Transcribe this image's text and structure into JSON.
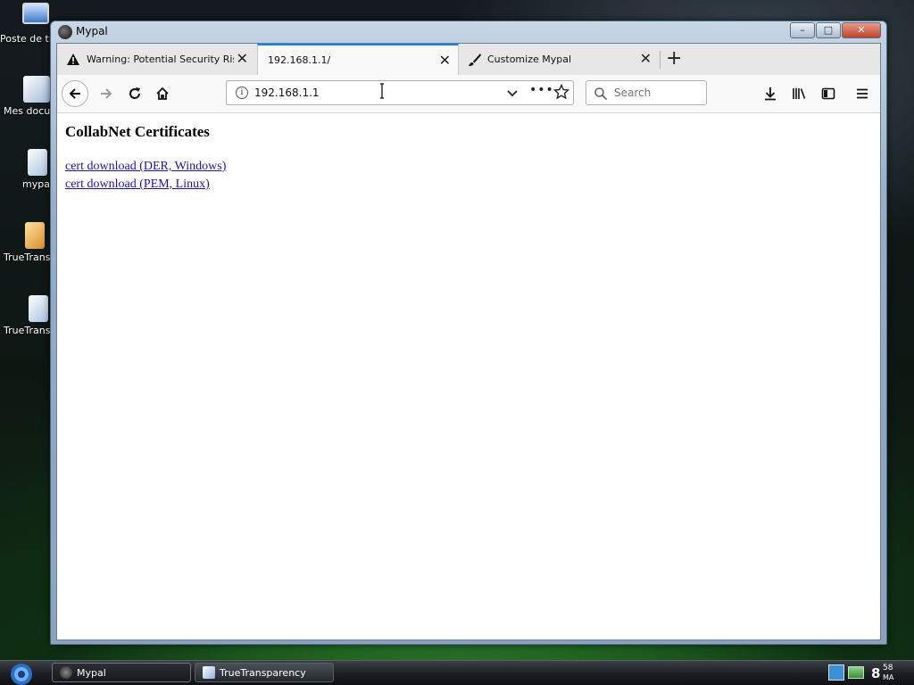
{
  "desktop": {
    "icons": [
      {
        "label": "Poste de travail"
      },
      {
        "label": "Mes docume"
      },
      {
        "label": "mypal"
      },
      {
        "label": "TrueTranspa"
      },
      {
        "label": "TrueTranspa"
      }
    ]
  },
  "window": {
    "title": "Mypal",
    "controls": {
      "minimize": "–",
      "maximize": "□",
      "close": "✕"
    }
  },
  "tabs": [
    {
      "label": "Warning: Potential Security Risk Ah",
      "icon": "warning-icon",
      "active": false
    },
    {
      "label": "192.168.1.1/",
      "active": true
    },
    {
      "label": "Customize Mypal",
      "icon": "brush-icon",
      "active": false
    }
  ],
  "tab_close_glyph": "✕",
  "new_tab_glyph": "+",
  "navbar": {
    "url": "192.168.1.1",
    "info_glyph": "i",
    "more_glyph": "•••",
    "search_placeholder": "Search",
    "menu_glyph": "≡"
  },
  "page": {
    "title": "CollabNet Certificates",
    "links": [
      "cert download (DER, Windows)",
      "cert download (PEM, Linux)"
    ]
  },
  "taskbar": {
    "tasks": [
      {
        "label": "Mypal",
        "active": true
      },
      {
        "label": "TrueTransparency",
        "active": false
      }
    ],
    "clock_hour": "8",
    "clock_minutes": "58",
    "clock_ampm": "MA"
  }
}
